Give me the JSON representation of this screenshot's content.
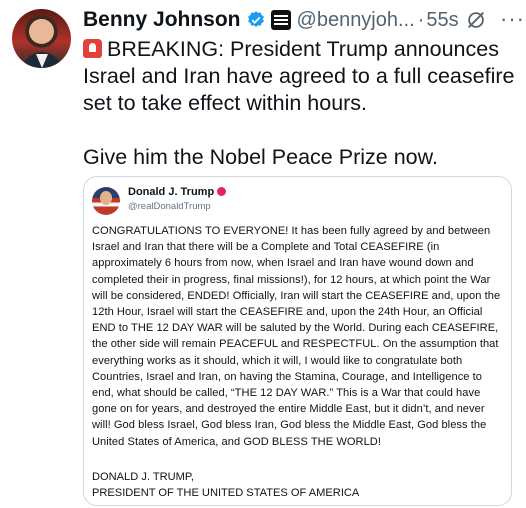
{
  "post": {
    "author_name": "Benny Johnson",
    "author_handle": "@bennyjoh...",
    "separator": "·",
    "timestamp": "55s",
    "text_line1": "BREAKING: President Trump announces Israel and Iran have agreed to a full ceasefire set to take effect within hours.",
    "text_line2": "Give him the Nobel Peace Prize now.",
    "more_label": "···"
  },
  "quoted": {
    "author_name": "Donald J. Trump",
    "author_handle": "@realDonaldTrump",
    "body": "CONGRATULATIONS TO EVERYONE! It has been fully agreed by and between Israel and Iran that there will be a Complete and Total CEASEFIRE (in approximately 6 hours from now, when Israel and Iran have wound down and completed their in progress, final missions!), for 12 hours, at which point the War will be considered, ENDED! Officially, Iran will start the CEASEFIRE and, upon the 12th Hour, Israel will start the CEASEFIRE and, upon the 24th Hour, an Official END to THE 12 DAY WAR will be saluted by the World. During each CEASEFIRE, the other side will remain PEACEFUL and RESPECTFUL. On the assumption that everything works as it should, which it will, I would like to congratulate both Countries, Israel and Iran, on having the Stamina, Courage, and Intelligence to end, what should be called, “THE 12 DAY WAR.” This is a War that could have gone on for years, and destroyed the entire Middle East, but it didn’t, and never will! God bless Israel, God bless Iran, God bless the Middle East, God bless the United States of America, and GOD BLESS THE WORLD!",
    "signature_line1": "DONALD J. TRUMP,",
    "signature_line2": "PRESIDENT OF THE UNITED STATES OF AMERICA"
  },
  "icons": {
    "verified": "verified-badge-icon",
    "affiliate": "affiliate-logo-icon",
    "grok": "grok-icon",
    "siren": "siren-emoji-icon"
  },
  "colors": {
    "verified_blue": "#1d9bf0",
    "secondary_text": "#536471",
    "border": "#cfd9de"
  }
}
